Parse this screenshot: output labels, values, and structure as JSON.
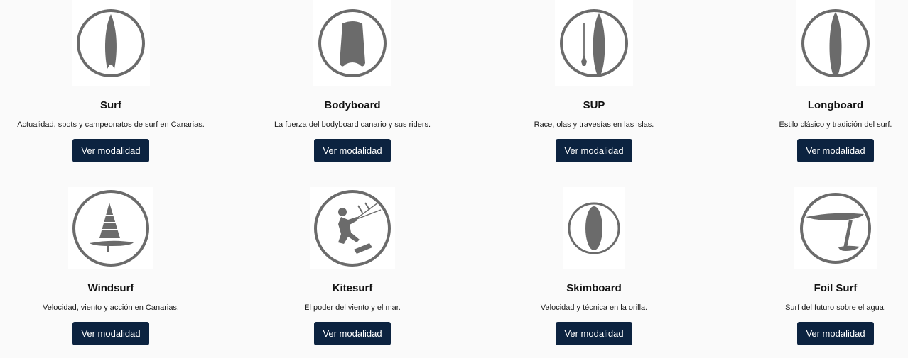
{
  "cards": [
    {
      "icon": "surfboard-icon",
      "title": "Surf",
      "description": "Actualidad, spots y campeonatos de surf en Canarias.",
      "button": "Ver modalidad"
    },
    {
      "icon": "bodyboard-icon",
      "title": "Bodyboard",
      "description": "La fuerza del bodyboard canario y sus riders.",
      "button": "Ver modalidad"
    },
    {
      "icon": "sup-icon",
      "title": "SUP",
      "description": "Race, olas y travesías en las islas.",
      "button": "Ver modalidad"
    },
    {
      "icon": "longboard-icon",
      "title": "Longboard",
      "description": "Estilo clásico y tradición del surf.",
      "button": "Ver modalidad"
    },
    {
      "icon": "windsurf-icon",
      "title": "Windsurf",
      "description": "Velocidad, viento y acción en Canarias.",
      "button": "Ver modalidad"
    },
    {
      "icon": "kitesurf-icon",
      "title": "Kitesurf",
      "description": "El poder del viento y el mar.",
      "button": "Ver modalidad"
    },
    {
      "icon": "skimboard-icon",
      "title": "Skimboard",
      "description": "Velocidad y técnica en la orilla.",
      "button": "Ver modalidad"
    },
    {
      "icon": "foil-surf-icon",
      "title": "Foil Surf",
      "description": "Surf del futuro sobre el agua.",
      "button": "Ver modalidad"
    }
  ],
  "colors": {
    "button_bg": "#0c2340",
    "icon_gray": "#6b6b6b",
    "page_bg": "#fafafa"
  }
}
